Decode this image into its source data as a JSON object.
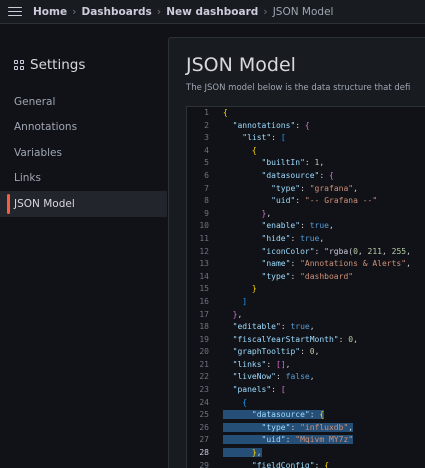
{
  "topbar": {
    "breadcrumbs": [
      "Home",
      "Dashboards",
      "New dashboard",
      "JSON Model"
    ]
  },
  "sidebar": {
    "title": "Settings",
    "items": [
      {
        "label": "General",
        "active": false
      },
      {
        "label": "Annotations",
        "active": false
      },
      {
        "label": "Variables",
        "active": false
      },
      {
        "label": "Links",
        "active": false
      },
      {
        "label": "JSON Model",
        "active": true
      }
    ]
  },
  "main": {
    "title": "JSON Model",
    "description": "The JSON model below is the data structure that defi"
  },
  "editor": {
    "current_line": 28,
    "selected_lines": [
      25,
      26,
      27,
      28
    ],
    "lines": [
      "{",
      "  \"annotations\": {",
      "    \"list\": [",
      "      {",
      "        \"builtIn\": 1,",
      "        \"datasource\": {",
      "          \"type\": \"grafana\",",
      "          \"uid\": \"-- Grafana --\"",
      "        },",
      "        \"enable\": true,",
      "        \"hide\": true,",
      "        \"iconColor\": \"rgba(0, 211, 255,",
      "        \"name\": \"Annotations & Alerts\",",
      "        \"type\": \"dashboard\"",
      "      }",
      "    ]",
      "  },",
      "  \"editable\": true,",
      "  \"fiscalYearStartMonth\": 0,",
      "  \"graphTooltip\": 0,",
      "  \"links\": [],",
      "  \"liveNow\": false,",
      "  \"panels\": [",
      "    {",
      "      \"datasource\": {",
      "        \"type\": \"influxdb\",",
      "        \"uid\": \"Mqivm MY7z\"",
      "      },",
      "      \"fieldConfig\": {"
    ]
  },
  "colors": {
    "accent": "#f55f3e",
    "background": "#111217",
    "panel": "#181b1f",
    "selection": "#264f78"
  }
}
